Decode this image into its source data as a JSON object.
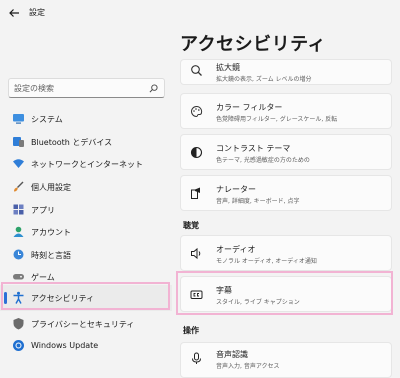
{
  "app": {
    "title": "設定"
  },
  "page": {
    "title": "アクセシビリティ"
  },
  "search": {
    "placeholder": "設定の検索"
  },
  "sidebar": {
    "items": [
      {
        "label": "システム"
      },
      {
        "label": "Bluetooth とデバイス"
      },
      {
        "label": "ネットワークとインターネット"
      },
      {
        "label": "個人用設定"
      },
      {
        "label": "アプリ"
      },
      {
        "label": "アカウント"
      },
      {
        "label": "時刻と言語"
      },
      {
        "label": "ゲーム"
      },
      {
        "label": "アクセシビリティ"
      },
      {
        "label": "プライバシーとセキュリティ"
      },
      {
        "label": "Windows Update"
      }
    ],
    "selected": "アクセシビリティ"
  },
  "main": {
    "cards": [
      {
        "title": "拡大鏡",
        "subtitle": "拡大鏡の表示, ズーム レベルの増分"
      },
      {
        "title": "カラー フィルター",
        "subtitle": "色覚障碍用フィルター, グレースケール, 反転"
      },
      {
        "title": "コントラスト テーマ",
        "subtitle": "色テーマ, 光感過敏症の方のための"
      },
      {
        "title": "ナレーター",
        "subtitle": "音声, 詳細度, キーボード, 点字"
      }
    ],
    "sections": [
      {
        "label": "聴覚"
      },
      {
        "label": "操作"
      }
    ],
    "hearing_cards": [
      {
        "title": "オーディオ",
        "subtitle": "モノラル オーディオ, オーディオ通知"
      },
      {
        "title": "字幕",
        "subtitle": "スタイル, ライブ キャプション"
      }
    ],
    "interaction_cards": [
      {
        "title": "音声認識",
        "subtitle": "音声入力, 音声アクセス"
      }
    ]
  },
  "colors": {
    "accent": "#2b6fd6",
    "highlight": "#f2b3d3",
    "background": "#f3f3f3"
  }
}
